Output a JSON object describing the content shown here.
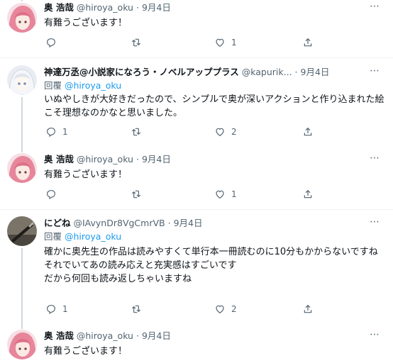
{
  "tweets": [
    {
      "name": "奥 浩哉",
      "handle": "@hiroya_oku",
      "dot": "·",
      "date": "9月4日",
      "reply_label": "",
      "reply_to": "",
      "text": "有難うございます！",
      "counts": {
        "reply": "",
        "retweet": "",
        "like": "1"
      }
    },
    {
      "name": "神達万丞@小説家になろう・ノベルアッププラス",
      "handle": "@kapurik...",
      "dot": "·",
      "date": "9月4日",
      "reply_label": "回覆",
      "reply_to": "@hiroya_oku",
      "text": "いぬやしきが大好きだったので、シンプルで奥が深いアクションと作り込まれた絵こそ理想なのかなと思いました。",
      "counts": {
        "reply": "1",
        "retweet": "",
        "like": "2"
      }
    },
    {
      "name": "奥 浩哉",
      "handle": "@hiroya_oku",
      "dot": "·",
      "date": "9月4日",
      "reply_label": "",
      "reply_to": "",
      "text": "有難うございます！",
      "counts": {
        "reply": "",
        "retweet": "",
        "like": "1"
      }
    },
    {
      "name": "にどね",
      "handle": "@IAvynDr8VgCmrVB",
      "dot": "·",
      "date": "9月4日",
      "reply_label": "回覆",
      "reply_to": "@hiroya_oku",
      "text": "確かに奥先生の作品は読みやすくて単行本一冊読むのに10分もかからないですね\nそれでいてあの読み応えと充実感はすごいです\nだから何回も読み返しちゃいますね",
      "counts": {
        "reply": "1",
        "retweet": "",
        "like": "2"
      }
    },
    {
      "name": "奥 浩哉",
      "handle": "@hiroya_oku",
      "dot": "·",
      "date": "9月4日",
      "reply_label": "",
      "reply_to": "",
      "text": "有難うございます！",
      "counts": {
        "reply": "",
        "retweet": "",
        "like": ""
      }
    }
  ],
  "colors": {
    "text": "#0f1419",
    "secondary": "#536471",
    "link": "#1d9bf0",
    "divider": "#eff3f4",
    "thread_line": "#cfd9de"
  },
  "icons": [
    "more-icon",
    "reply-icon",
    "retweet-icon",
    "like-icon",
    "share-icon"
  ]
}
